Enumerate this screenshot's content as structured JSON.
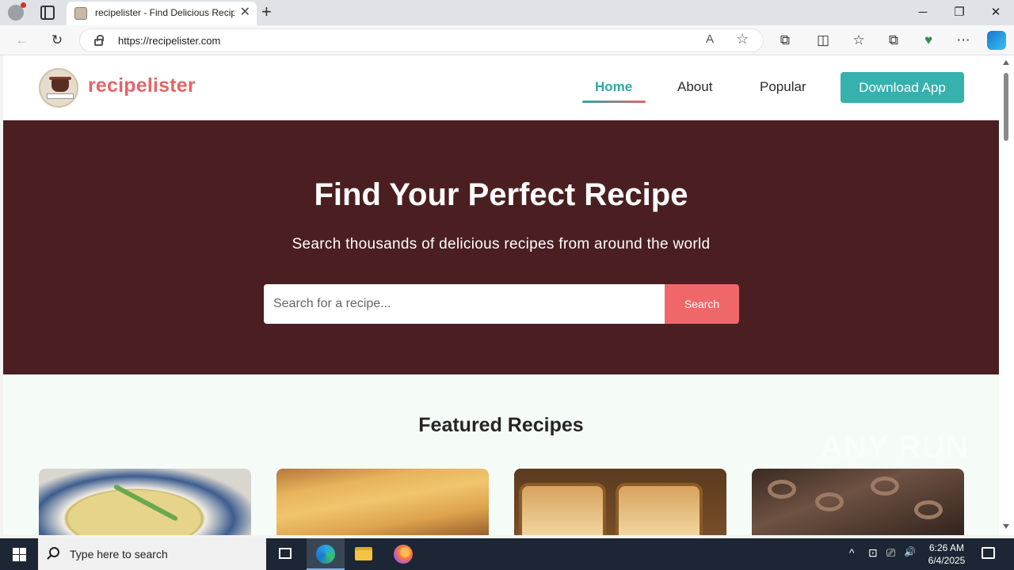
{
  "browser": {
    "tab_title": "recipelister - Find Delicious Recip",
    "tab_close": "✕",
    "new_tab": "+",
    "url": "https://recipelister.com",
    "window_controls": {
      "minimize": "─",
      "restore": "❐",
      "close": "✕"
    },
    "nav_icons": {
      "back": "←",
      "refresh": "↻",
      "read_aloud": "A",
      "favorite": "☆",
      "extensions": "⧉",
      "split": "◫",
      "favorites": "☆",
      "collections": "⧉",
      "copilot_health": "♥",
      "more": "⋯"
    }
  },
  "site": {
    "brand": "recipelister",
    "nav": [
      {
        "label": "Home",
        "active": true
      },
      {
        "label": "About",
        "active": false
      },
      {
        "label": "Popular",
        "active": false
      }
    ],
    "download_label": "Download App",
    "hero": {
      "title": "Find Your Perfect Recipe",
      "subtitle": "Search thousands of delicious recipes from around the world",
      "search_placeholder": "Search for a recipe...",
      "search_button": "Search"
    },
    "featured_title": "Featured Recipes"
  },
  "watermark": "ANY RUN",
  "taskbar": {
    "search_placeholder": "Type here to search",
    "time": "6:26 AM",
    "date": "6/4/2025",
    "tray_icons": [
      "^",
      "⊡",
      "⎚",
      "🔊"
    ]
  },
  "colors": {
    "brand": "#e56467",
    "accent": "#35b1ae",
    "hero_bg": "#4b1f21",
    "search_button": "#f0676a"
  }
}
